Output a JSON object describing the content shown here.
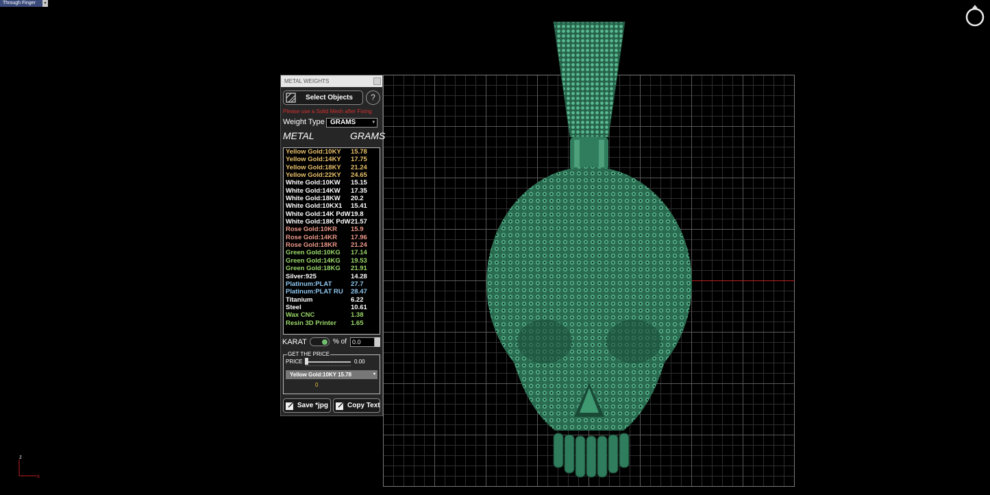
{
  "viewport": {
    "tab_label": "Through Finger",
    "tab_arrow": "▾"
  },
  "panel": {
    "title": "METAL WEIGHTS",
    "select_objects": "Select Objects",
    "help": "?",
    "warning": "Please use a Solid Mesh after Fixing",
    "weight_type_label": "Weight Type",
    "weight_type_value": "GRAMS",
    "col_metal": "METAL",
    "col_grams": "GRAMS",
    "metals": [
      {
        "name": "Yellow Gold:10KY",
        "value": "15.78",
        "color": "#e8c06a"
      },
      {
        "name": "Yellow Gold:14KY",
        "value": "17.75",
        "color": "#e8c06a"
      },
      {
        "name": "Yellow Gold:18KY",
        "value": "21.24",
        "color": "#e8c06a"
      },
      {
        "name": "Yellow Gold:22KY",
        "value": "24.65",
        "color": "#e8c06a"
      },
      {
        "name": "White Gold:10KW",
        "value": "15.15",
        "color": "#ffffff"
      },
      {
        "name": "White Gold:14KW",
        "value": "17.35",
        "color": "#ffffff"
      },
      {
        "name": "White Gold:18KW",
        "value": "20.2",
        "color": "#ffffff"
      },
      {
        "name": "White Gold:10KX1",
        "value": "15.41",
        "color": "#ffffff"
      },
      {
        "name": "White Gold:14K PdW",
        "value": "19.8",
        "color": "#ffffff"
      },
      {
        "name": "White Gold:18K PdW",
        "value": "21.57",
        "color": "#ffffff"
      },
      {
        "name": "Rose Gold:10KR",
        "value": "15.9",
        "color": "#ef9a8a"
      },
      {
        "name": "Rose Gold:14KR",
        "value": "17.96",
        "color": "#ef9a8a"
      },
      {
        "name": "Rose Gold:18KR",
        "value": "21.24",
        "color": "#ef9a8a"
      },
      {
        "name": "Green Gold:10KG",
        "value": "17.14",
        "color": "#9ad86a"
      },
      {
        "name": "Green Gold:14KG",
        "value": "19.53",
        "color": "#9ad86a"
      },
      {
        "name": "Green Gold:18KG",
        "value": "21.91",
        "color": "#9ad86a"
      },
      {
        "name": "Silver:925",
        "value": "14.28",
        "color": "#ffffff"
      },
      {
        "name": "Platinum:PLAT",
        "value": "27.7",
        "color": "#8fc8f0"
      },
      {
        "name": "Platinum:PLAT RU",
        "value": "28.47",
        "color": "#8fc8f0"
      },
      {
        "name": "Titanium",
        "value": "6.22",
        "color": "#ffffff"
      },
      {
        "name": "Steel",
        "value": "10.61",
        "color": "#ffffff"
      },
      {
        "name": "Wax  CNC",
        "value": "1.38",
        "color": "#9ad86a"
      },
      {
        "name": "Resin 3D Printer",
        "value": "1.65",
        "color": "#9ad86a"
      }
    ],
    "karat_label": "KARAT",
    "percent_of": "% of",
    "percent_value": "0.0",
    "price_legend": "GET THE PRICE",
    "price_label": "PRICE",
    "price_value": "0.00",
    "price_slider_fraction": 0,
    "price_selected": "Yellow Gold:10KY 15.78",
    "price_result": "0",
    "save_label": "Save *jpg",
    "copy_label": "Copy  Text"
  },
  "axes": {
    "z": "z",
    "x": "x"
  },
  "colors": {
    "model": "#2e7a5a",
    "grid": "#5a5a5a",
    "accent_red": "#c02020"
  }
}
